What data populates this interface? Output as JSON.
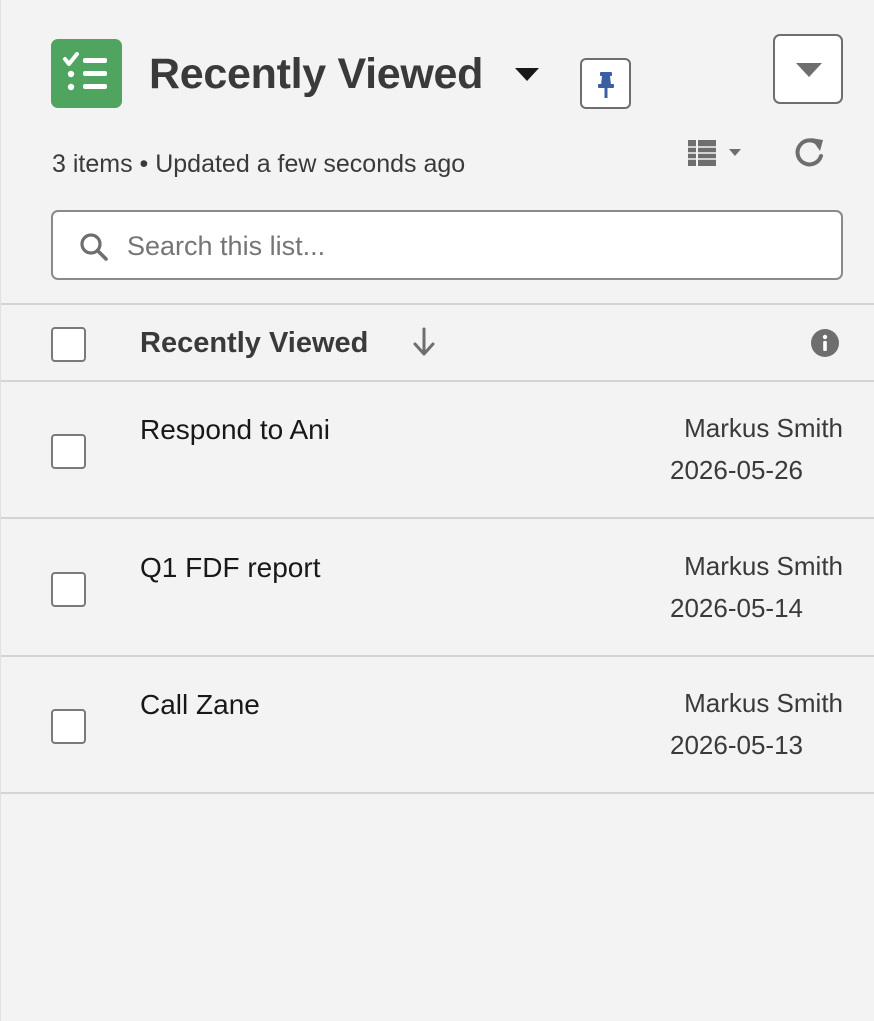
{
  "header": {
    "title": "Recently Viewed",
    "status": "3 items • Updated a few seconds ago",
    "app_icon": "task-list-icon",
    "title_menu_icon": "caret-down-icon",
    "pin_icon": "pin-icon",
    "actions_icon": "caret-down-icon",
    "display_icon": "table-view-icon",
    "refresh_icon": "refresh-icon"
  },
  "search": {
    "placeholder": "Search this list...",
    "value": "",
    "icon": "search-icon"
  },
  "table": {
    "column_header": "Recently Viewed",
    "sort_icon": "arrow-down-icon",
    "info_icon": "info-icon",
    "rows": [
      {
        "name": "Respond to Ani",
        "owner": "Markus Smith",
        "date": "2026-05-26"
      },
      {
        "name": "Q1 FDF report",
        "owner": "Markus Smith",
        "date": "2026-05-14"
      },
      {
        "name": "Call Zane",
        "owner": "Markus Smith",
        "date": "2026-05-13"
      }
    ]
  },
  "colors": {
    "brand_green": "#4fa55f",
    "pin_blue": "#3b5fa5",
    "background": "#f3f3f3"
  }
}
